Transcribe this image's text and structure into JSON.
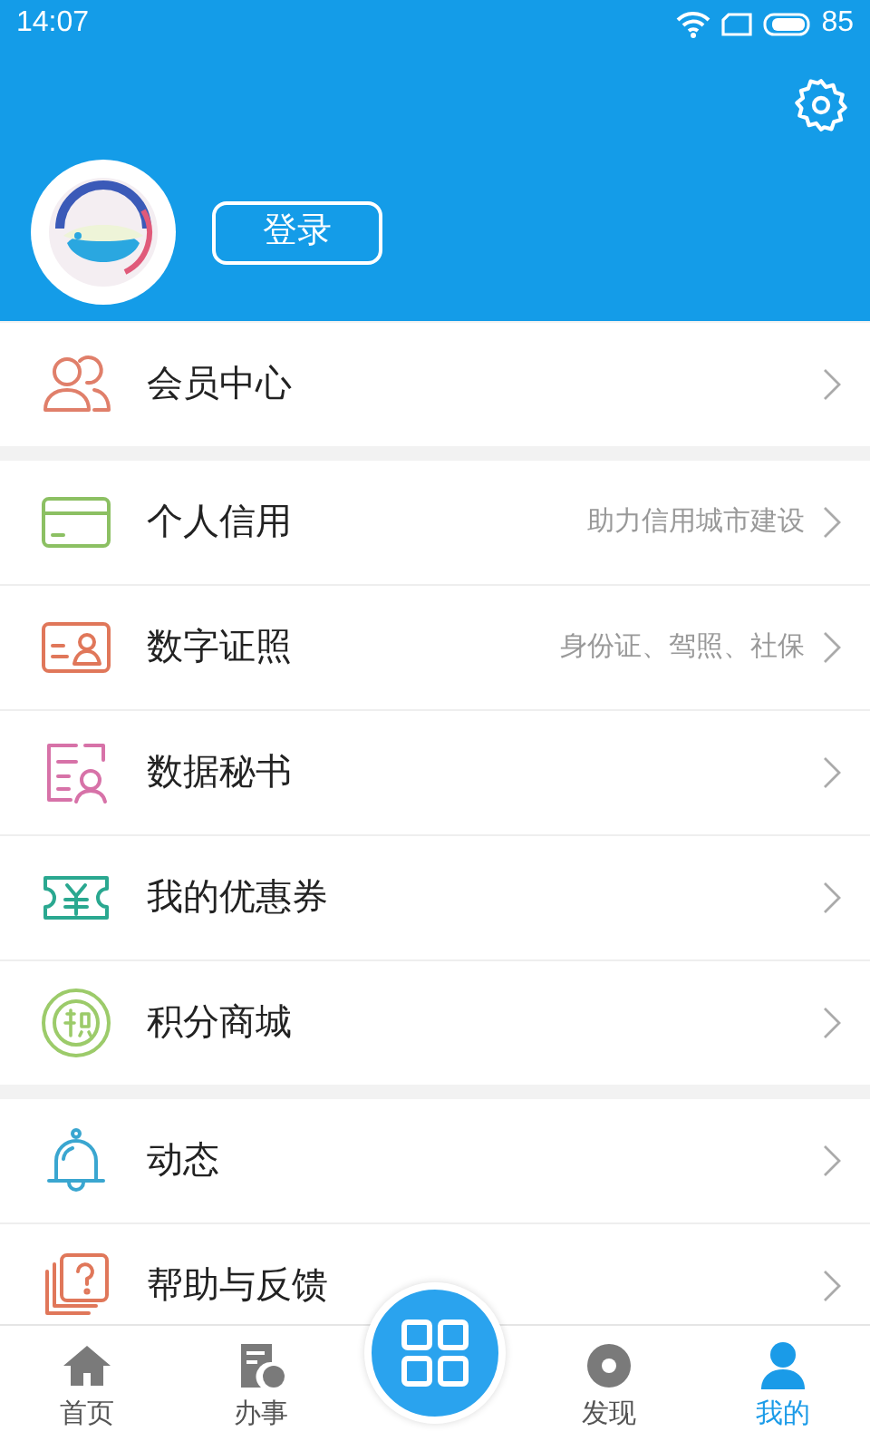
{
  "status_bar": {
    "time": "14:07",
    "battery": "85"
  },
  "profile": {
    "login_button": "登录"
  },
  "menu_groups": [
    {
      "items": [
        {
          "label": "会员中心"
        }
      ]
    },
    {
      "items": [
        {
          "label": "个人信用",
          "hint": "助力信用城市建设"
        },
        {
          "label": "数字证照",
          "hint": "身份证、驾照、社保"
        },
        {
          "label": "数据秘书"
        },
        {
          "label": "我的优惠券"
        },
        {
          "label": "积分商城"
        }
      ]
    },
    {
      "items": [
        {
          "label": "动态"
        },
        {
          "label": "帮助与反馈"
        }
      ]
    }
  ],
  "bottom_nav": [
    {
      "label": "首页",
      "selected": false
    },
    {
      "label": "办事",
      "selected": false
    },
    {
      "label": "发现",
      "selected": false
    },
    {
      "label": "我的",
      "selected": true
    }
  ]
}
